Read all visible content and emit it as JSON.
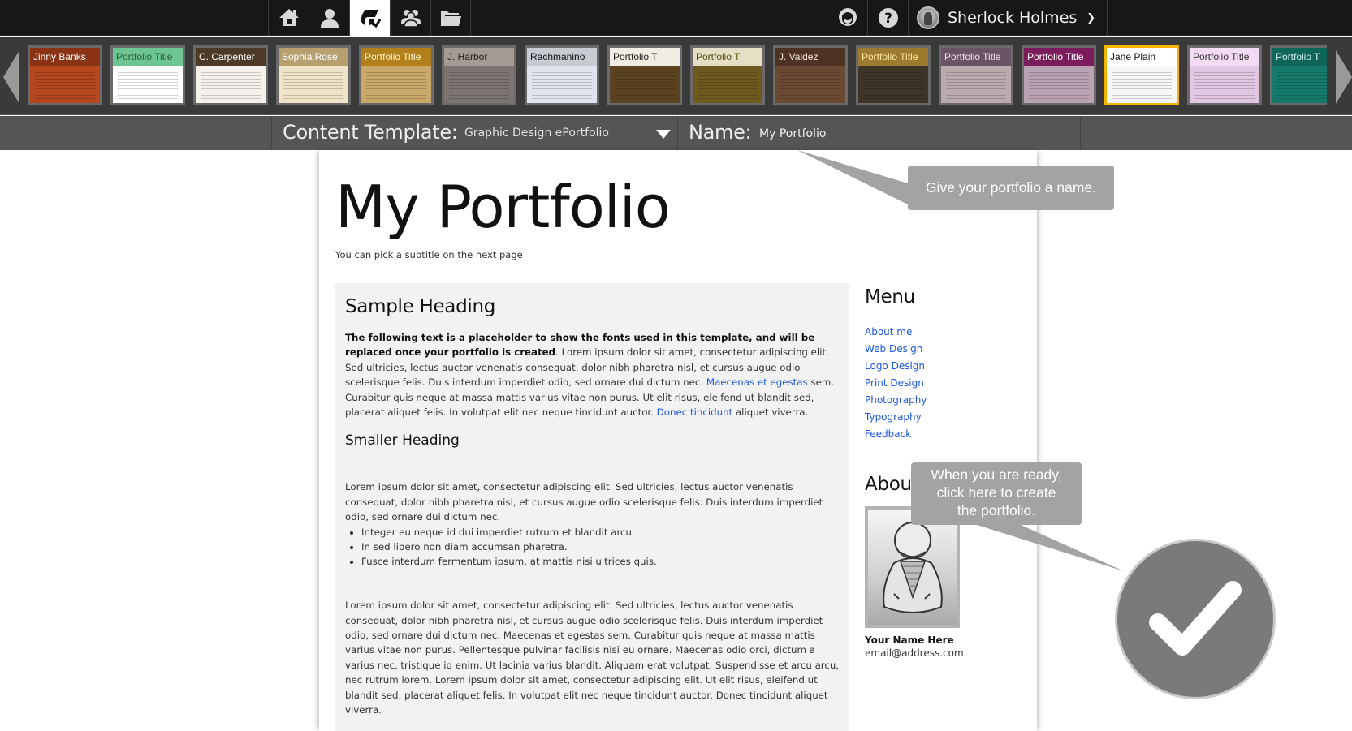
{
  "topbar": {
    "nav_icons": [
      {
        "name": "home-icon",
        "active": false
      },
      {
        "name": "profile-icon",
        "active": false
      },
      {
        "name": "portfolio-icon",
        "active": true
      },
      {
        "name": "groups-icon",
        "active": false
      },
      {
        "name": "files-icon",
        "active": false
      }
    ],
    "right_icons": [
      {
        "name": "support-icon"
      },
      {
        "name": "help-icon"
      }
    ],
    "user": {
      "name": "Sherlock Holmes",
      "menu_icon": "chevron-down-icon"
    }
  },
  "template_strip": {
    "prev_icon": "arrow-left-icon",
    "next_icon": "arrow-right-icon",
    "templates": [
      {
        "title": "Jinny Banks",
        "bg": "#b4471d",
        "band": "#8a3315",
        "fg": "#ffffff",
        "selected": false
      },
      {
        "title": "Portfolio Title",
        "bg": "#ffffff",
        "band": "#6cc592",
        "fg": "#2f5b3e",
        "selected": false
      },
      {
        "title": "C. Carpenter",
        "bg": "#f4f1ea",
        "band": "#4d3a26",
        "fg": "#ffffff",
        "selected": false
      },
      {
        "title": "Sophia Rose",
        "bg": "#efe4c8",
        "band": "#b89f70",
        "fg": "#ffffff",
        "selected": false
      },
      {
        "title": "Portfolio Title",
        "bg": "#c9a869",
        "band": "#b27f1d",
        "fg": "#fff4c8",
        "selected": false
      },
      {
        "title": "J. Harbor",
        "bg": "#7c7470",
        "band": "#a49c92",
        "fg": "#222222",
        "selected": false
      },
      {
        "title": "Rachmanino",
        "bg": "#dfe5ec",
        "band": "#c8ccd2",
        "fg": "#111111",
        "selected": false
      },
      {
        "title": "Portfolio T",
        "bg": "#5b4322",
        "band": "#f1ede2",
        "fg": "#222222",
        "selected": false
      },
      {
        "title": "Portfolio T",
        "bg": "#6e5a1e",
        "band": "#e5dfc6",
        "fg": "#5a4c10",
        "selected": false
      },
      {
        "title": "J. Valdez",
        "bg": "#6b4a34",
        "band": "#4e3324",
        "fg": "#f6e8d8",
        "selected": false
      },
      {
        "title": "Portfolio Title",
        "bg": "#3d3527",
        "band": "#9c7a2e",
        "fg": "#ffe9a8",
        "selected": false
      },
      {
        "title": "Portfolio Title",
        "bg": "#b9abb0",
        "band": "#6b5366",
        "fg": "#f2e4ee",
        "selected": false
      },
      {
        "title": "Portfolio Title",
        "bg": "#b9a3b3",
        "band": "#7b1d5c",
        "fg": "#ffffff",
        "selected": false
      },
      {
        "title": "Jane Plain",
        "bg": "#f6f6f6",
        "band": "#ffffff",
        "fg": "#111111",
        "selected": true
      },
      {
        "title": "Portfolio Title",
        "bg": "#e2c7e2",
        "band": "#f3dcf3",
        "fg": "#333333",
        "selected": false
      },
      {
        "title": "Portfolio T",
        "bg": "#157a69",
        "band": "#0f6658",
        "fg": "#cfeee7",
        "selected": false
      }
    ]
  },
  "settings_bar": {
    "content_template_label": "Content Template:",
    "content_template_value": "Graphic Design ePortfolio",
    "dropdown_icon": "caret-down-icon",
    "name_label": "Name:",
    "name_value": "My Portfolio"
  },
  "preview": {
    "title": "My Portfolio",
    "subtitle": "You can pick a subtitle on the next page",
    "main": {
      "heading": "Sample Heading",
      "para1_bold": "The following text is a placeholder to show the fonts used in this template, and will be replaced once your portfolio is created",
      "para1_a": ". Lorem ipsum dolor sit amet, consectetur adipiscing elit. Sed ultricies, lectus auctor venenatis consequat, dolor nibh pharetra nisl, et cursus augue odio scelerisque felis. Duis interdum imperdiet odio, sed ornare dui dictum nec. ",
      "para1_link1": "Maecenas et egestas",
      "para1_b": " sem. Curabitur quis neque at massa mattis varius vitae non purus. Ut elit risus, eleifend ut blandit sed, placerat aliquet felis. In volutpat elit nec neque tincidunt auctor. ",
      "para1_link2": "Donec tincidunt",
      "para1_c": " aliquet viverra.",
      "subheading": "Smaller Heading",
      "para2": "Lorem ipsum dolor sit amet, consectetur adipiscing elit. Sed ultricies, lectus auctor venenatis consequat, dolor nibh pharetra nisl, et cursus augue odio scelerisque felis. Duis interdum imperdiet odio, sed ornare dui dictum nec.",
      "list": [
        "Integer eu neque id dui imperdiet rutrum et blandit arcu.",
        "In sed libero non diam accumsan pharetra.",
        "Fusce interdum fermentum ipsum, at mattis nisi ultrices quis."
      ],
      "para3": "Lorem ipsum dolor sit amet, consectetur adipiscing elit. Sed ultricies, lectus auctor venenatis consequat, dolor nibh pharetra nisl, et cursus augue odio scelerisque felis. Duis interdum imperdiet odio, sed ornare dui dictum nec. Maecenas et egestas sem. Curabitur quis neque at massa mattis varius vitae non purus. Pellentesque pulvinar facilisis nisi eu ornare. Maecenas odio orci, dictum a varius nec, tristique id enim. Ut lacinia varius blandit. Aliquam erat volutpat. Suspendisse et arcu arcu, nec rutrum lorem. Lorem ipsum dolor sit amet, consectetur adipiscing elit. Ut elit risus, eleifend ut blandit sed, placerat aliquet felis. In volutpat elit nec neque tincidunt auctor. Donec tincidunt aliquet viverra."
    },
    "sidebar": {
      "menu_heading": "Menu",
      "menu_items": [
        "About me",
        "Web Design",
        "Logo Design",
        "Print Design",
        "Photography",
        "Typography",
        "Feedback"
      ],
      "about_heading": "About",
      "photo_icon": "user-sketch-icon",
      "your_name": "Your Name Here",
      "email": "email@address.com"
    }
  },
  "callouts": {
    "name_hint": "Give your portfolio a name.",
    "create_hint_lines": [
      "When you are ready,",
      "click here to create",
      "the portfolio."
    ]
  },
  "create_button": {
    "icon": "checkmark-icon",
    "color": "#7a7a7a"
  },
  "colors": {
    "topbar_bg": "#171717",
    "strip_bg": "#3a3a3a",
    "settings_bg": "#555555",
    "selected_outline": "#f5b400",
    "link": "#1a56e0",
    "callout_bg": "#a3a3a3"
  }
}
